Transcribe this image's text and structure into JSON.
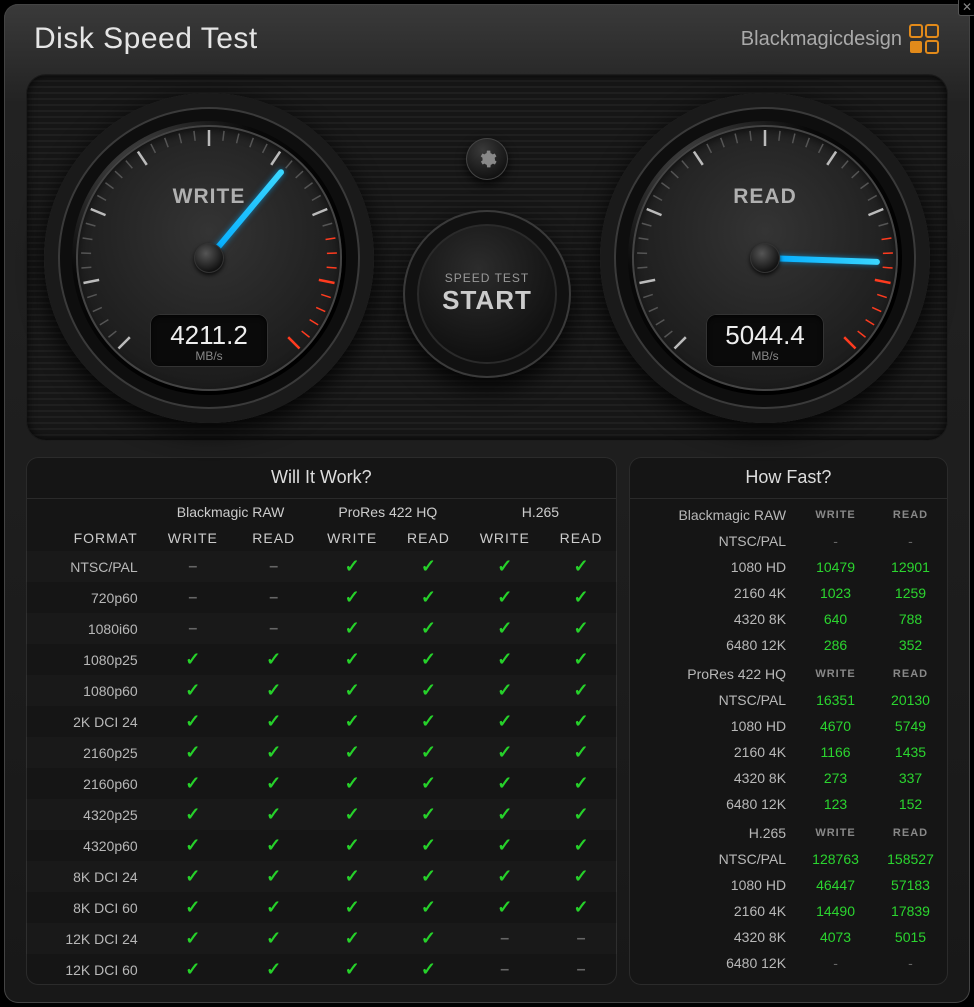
{
  "app": {
    "title": "Disk Speed Test",
    "brand": "Blackmagicdesign"
  },
  "gauges": {
    "write": {
      "label": "WRITE",
      "value": "4211.2",
      "unit": "MB/s",
      "angle": -50
    },
    "read": {
      "label": "READ",
      "value": "5044.4",
      "unit": "MB/s",
      "angle": 2
    }
  },
  "controls": {
    "settings_tooltip": "Settings",
    "start_small": "SPEED TEST",
    "start_big": "START"
  },
  "will_it_work": {
    "title": "Will It Work?",
    "format_header": "FORMAT",
    "codecs": [
      "Blackmagic RAW",
      "ProRes 422 HQ",
      "H.265"
    ],
    "subcols": [
      "WRITE",
      "READ"
    ],
    "rows": [
      {
        "name": "NTSC/PAL",
        "cells": [
          "dash",
          "dash",
          "check",
          "check",
          "check",
          "check"
        ]
      },
      {
        "name": "720p60",
        "cells": [
          "dash",
          "dash",
          "check",
          "check",
          "check",
          "check"
        ]
      },
      {
        "name": "1080i60",
        "cells": [
          "dash",
          "dash",
          "check",
          "check",
          "check",
          "check"
        ]
      },
      {
        "name": "1080p25",
        "cells": [
          "check",
          "check",
          "check",
          "check",
          "check",
          "check"
        ]
      },
      {
        "name": "1080p60",
        "cells": [
          "check",
          "check",
          "check",
          "check",
          "check",
          "check"
        ]
      },
      {
        "name": "2K DCI 24",
        "cells": [
          "check",
          "check",
          "check",
          "check",
          "check",
          "check"
        ]
      },
      {
        "name": "2160p25",
        "cells": [
          "check",
          "check",
          "check",
          "check",
          "check",
          "check"
        ]
      },
      {
        "name": "2160p60",
        "cells": [
          "check",
          "check",
          "check",
          "check",
          "check",
          "check"
        ]
      },
      {
        "name": "4320p25",
        "cells": [
          "check",
          "check",
          "check",
          "check",
          "check",
          "check"
        ]
      },
      {
        "name": "4320p60",
        "cells": [
          "check",
          "check",
          "check",
          "check",
          "check",
          "check"
        ]
      },
      {
        "name": "8K DCI 24",
        "cells": [
          "check",
          "check",
          "check",
          "check",
          "check",
          "check"
        ]
      },
      {
        "name": "8K DCI 60",
        "cells": [
          "check",
          "check",
          "check",
          "check",
          "check",
          "check"
        ]
      },
      {
        "name": "12K DCI 24",
        "cells": [
          "check",
          "check",
          "check",
          "check",
          "dash",
          "dash"
        ]
      },
      {
        "name": "12K DCI 60",
        "cells": [
          "check",
          "check",
          "check",
          "check",
          "dash",
          "dash"
        ]
      }
    ]
  },
  "how_fast": {
    "title": "How Fast?",
    "subcols": [
      "WRITE",
      "READ"
    ],
    "groups": [
      {
        "codec": "Blackmagic RAW",
        "rows": [
          {
            "name": "NTSC/PAL",
            "write": "-",
            "read": "-"
          },
          {
            "name": "1080 HD",
            "write": "10479",
            "read": "12901"
          },
          {
            "name": "2160 4K",
            "write": "1023",
            "read": "1259"
          },
          {
            "name": "4320 8K",
            "write": "640",
            "read": "788"
          },
          {
            "name": "6480 12K",
            "write": "286",
            "read": "352"
          }
        ]
      },
      {
        "codec": "ProRes 422 HQ",
        "rows": [
          {
            "name": "NTSC/PAL",
            "write": "16351",
            "read": "20130"
          },
          {
            "name": "1080 HD",
            "write": "4670",
            "read": "5749"
          },
          {
            "name": "2160 4K",
            "write": "1166",
            "read": "1435"
          },
          {
            "name": "4320 8K",
            "write": "273",
            "read": "337"
          },
          {
            "name": "6480 12K",
            "write": "123",
            "read": "152"
          }
        ]
      },
      {
        "codec": "H.265",
        "rows": [
          {
            "name": "NTSC/PAL",
            "write": "128763",
            "read": "158527"
          },
          {
            "name": "1080 HD",
            "write": "46447",
            "read": "57183"
          },
          {
            "name": "2160 4K",
            "write": "14490",
            "read": "17839"
          },
          {
            "name": "4320 8K",
            "write": "4073",
            "read": "5015"
          },
          {
            "name": "6480 12K",
            "write": "-",
            "read": "-"
          }
        ]
      }
    ]
  }
}
